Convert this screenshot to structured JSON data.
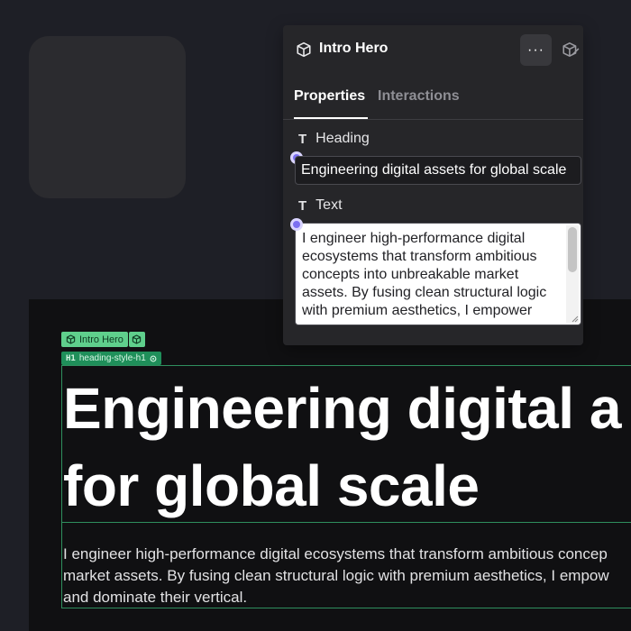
{
  "panel": {
    "title": "Intro Hero",
    "more_label": "···",
    "tabs": [
      {
        "label": "Properties"
      },
      {
        "label": "Interactions"
      }
    ],
    "fields": {
      "heading": {
        "icon": "T",
        "label": "Heading",
        "value": "Engineering digital assets for global scale"
      },
      "text": {
        "icon": "T",
        "label": "Text",
        "value": "I engineer high-performance digital ecosystems that transform ambitious concepts into unbreakable market assets. By fusing clean structural logic with premium aesthetics, I empower"
      }
    }
  },
  "canvas": {
    "component_tag": "Intro Hero",
    "class_tag_prefix": "H1",
    "class_tag": "heading-style-h1",
    "heading_lines": [
      "Engineering digital a",
      "for global scale"
    ],
    "text_lines": [
      "I engineer high-performance digital ecosystems that transform ambitious concep",
      "market assets. By fusing clean structural logic with premium aesthetics, I empow",
      "and dominate their vertical."
    ]
  },
  "colors": {
    "background": "#1e1f26",
    "panel": "#262629",
    "selection_green": "#5fcf8c",
    "class_green": "#1f8f5a",
    "accent_purple": "#7b6ff0"
  },
  "icons": [
    "cube-icon",
    "cube-outline-icon",
    "more-icon",
    "text-type-icon",
    "resize-grip-icon"
  ]
}
